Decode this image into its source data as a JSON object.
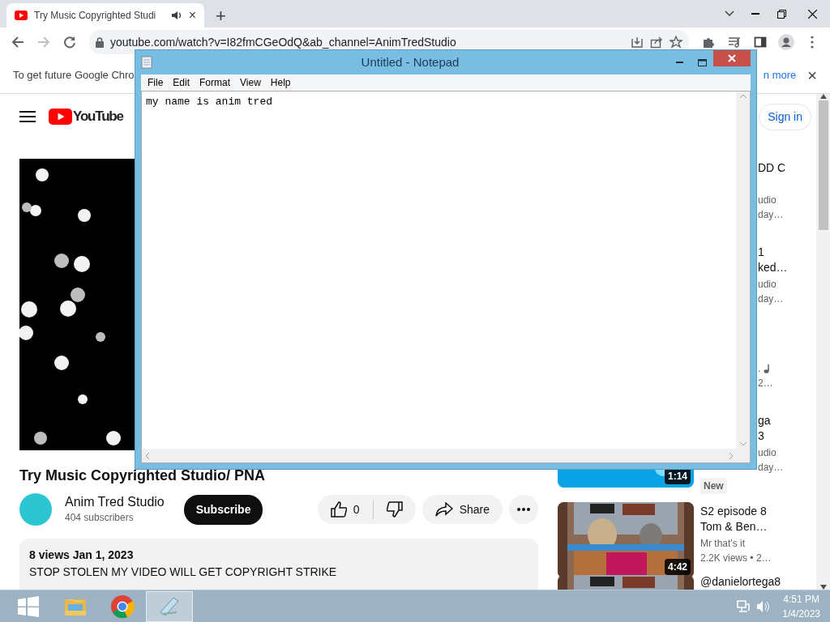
{
  "browser": {
    "tabs": [
      {
        "title": "Try Music Copyrighted Studi",
        "selected": true,
        "audio": true,
        "close": "×"
      }
    ],
    "new_tab": "+",
    "address": "youtube.com/watch?v=I82fmCGeOdQ&ab_channel=AnimTredStudio",
    "infobar": {
      "message": "To get future Google Chro",
      "link": "n more",
      "close": "×"
    }
  },
  "youtube": {
    "logo": "YouTube",
    "sign_in": "Sign in",
    "video": {
      "title": "Try Music Copyrighted Studio/ PNA"
    },
    "channel": {
      "name": "Anim Tred Studio",
      "subscribers": "404 subscribers",
      "subscribe": "Subscribe"
    },
    "actions": {
      "likes": "0",
      "share": "Share"
    },
    "description": {
      "meta": "8 views  Jan 1, 2023",
      "text": "STOP STOLEN  MY VIDEO WILL GET COPYRIGHT STRIKE"
    },
    "sidebar": [
      {
        "kind": "covered",
        "title": [
          "DD C"
        ],
        "channel": "udio",
        "views": "day…"
      },
      {
        "kind": "covered",
        "title": [
          "1",
          "ked…"
        ],
        "channel": "udio",
        "views": "day…"
      },
      {
        "kind": "covered",
        "channel": ".",
        "music_note": true,
        "views": "2…"
      },
      {
        "kind": "covered",
        "title": [
          "ga",
          "3"
        ],
        "channel": "udio",
        "views": "day…",
        "duration": "1:14",
        "badge": "New"
      },
      {
        "kind": "full",
        "title": [
          "S2 episode 8",
          "Tom & Ben…"
        ],
        "channel": "Mr that's it",
        "views": "2.2K views  • 2…",
        "duration": "4:42"
      },
      {
        "kind": "full",
        "title": [
          "@danielortega8"
        ]
      }
    ]
  },
  "notepad": {
    "title": "Untitled - Notepad",
    "menu": [
      "File",
      "Edit",
      "Format",
      "View",
      "Help"
    ],
    "text": "my name is anim tred"
  },
  "taskbar": {
    "apps": [
      {
        "kind": "explorer",
        "selected": false
      },
      {
        "kind": "chrome",
        "selected": false
      },
      {
        "kind": "notepad",
        "selected": true
      }
    ],
    "time": "4:51 PM",
    "date": "1/4/2023"
  }
}
